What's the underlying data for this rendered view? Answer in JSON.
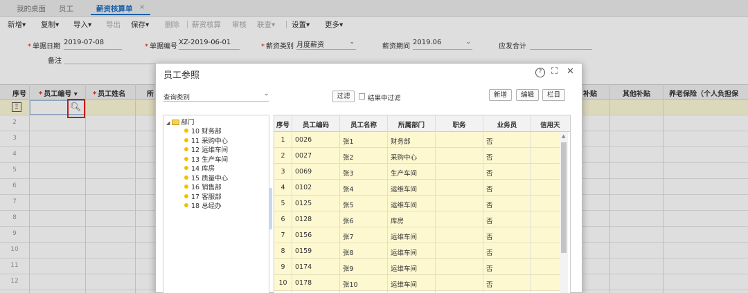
{
  "tabs": [
    {
      "label": "我的桌面"
    },
    {
      "label": "员工"
    },
    {
      "label": "薪资核算单",
      "close": "×"
    }
  ],
  "toolbar": {
    "items": [
      "新增",
      "复制",
      "导入",
      "导出",
      "保存",
      "删除",
      "薪资核算",
      "审核",
      "联查",
      "设置",
      "更多"
    ],
    "dropdown_mark": "▾"
  },
  "form": {
    "doc_date_label": "单据日期",
    "doc_date": "2019-07-08",
    "doc_no_label": "单据编号",
    "doc_no": "XZ-2019-06-01",
    "salary_type_label": "薪资类别",
    "salary_type": "月度薪资",
    "period_label": "薪资期间",
    "period": "2019.06",
    "total_label": "应发合计",
    "remark_label": "备注",
    "required_mark": "*"
  },
  "grid": {
    "headers": {
      "seq": "序号",
      "emp_code": "员工编号",
      "emp_name": "员工姓名",
      "dept": "所",
      "subsidy": "补贴",
      "other_subsidy": "其他补贴",
      "pension": "养老保险（个人负担保"
    },
    "sort_mark": "▾",
    "row_numbers": [
      "2",
      "3",
      "4",
      "5",
      "6",
      "7",
      "8",
      "9",
      "10",
      "11",
      "12"
    ]
  },
  "dialog": {
    "title": "员工参照",
    "help_icon": "?",
    "maximize_icon": "⛶",
    "close_icon": "✕",
    "query_label": "查询类别",
    "filter_button": "过滤",
    "filter_in_result": "结果中过滤",
    "add_button": "新增",
    "edit_button": "编辑",
    "column_button": "栏目",
    "tree": {
      "root": "部门",
      "children": [
        "10 财务部",
        "11 采购中心",
        "12 运维车间",
        "13 生产车间",
        "14 库房",
        "15 质量中心",
        "16 销售部",
        "17 客服部",
        "18 总经办"
      ]
    },
    "table": {
      "headers": [
        "序号",
        "员工编码",
        "员工名称",
        "所属部门",
        "职务",
        "业务员",
        "信用天"
      ],
      "rows": [
        [
          "1",
          "0026",
          "张1",
          "财务部",
          "",
          "否"
        ],
        [
          "2",
          "0027",
          "张2",
          "采购中心",
          "",
          "否"
        ],
        [
          "3",
          "0069",
          "张3",
          "生产车间",
          "",
          "否"
        ],
        [
          "4",
          "0102",
          "张4",
          "运维车间",
          "",
          "否"
        ],
        [
          "5",
          "0125",
          "张5",
          "运维车间",
          "",
          "否"
        ],
        [
          "6",
          "0128",
          "张6",
          "库房",
          "",
          "否"
        ],
        [
          "7",
          "0156",
          "张7",
          "运维车间",
          "",
          "否"
        ],
        [
          "8",
          "0159",
          "张8",
          "运维车间",
          "",
          "否"
        ],
        [
          "9",
          "0174",
          "张9",
          "运维车间",
          "",
          "否"
        ],
        [
          "10",
          "0178",
          "张10",
          "运维车间",
          "",
          "否"
        ]
      ]
    }
  },
  "colors": {
    "accent": "#1f6fc5",
    "highlight_row": "#fdf8d0",
    "required": "#e02020"
  }
}
